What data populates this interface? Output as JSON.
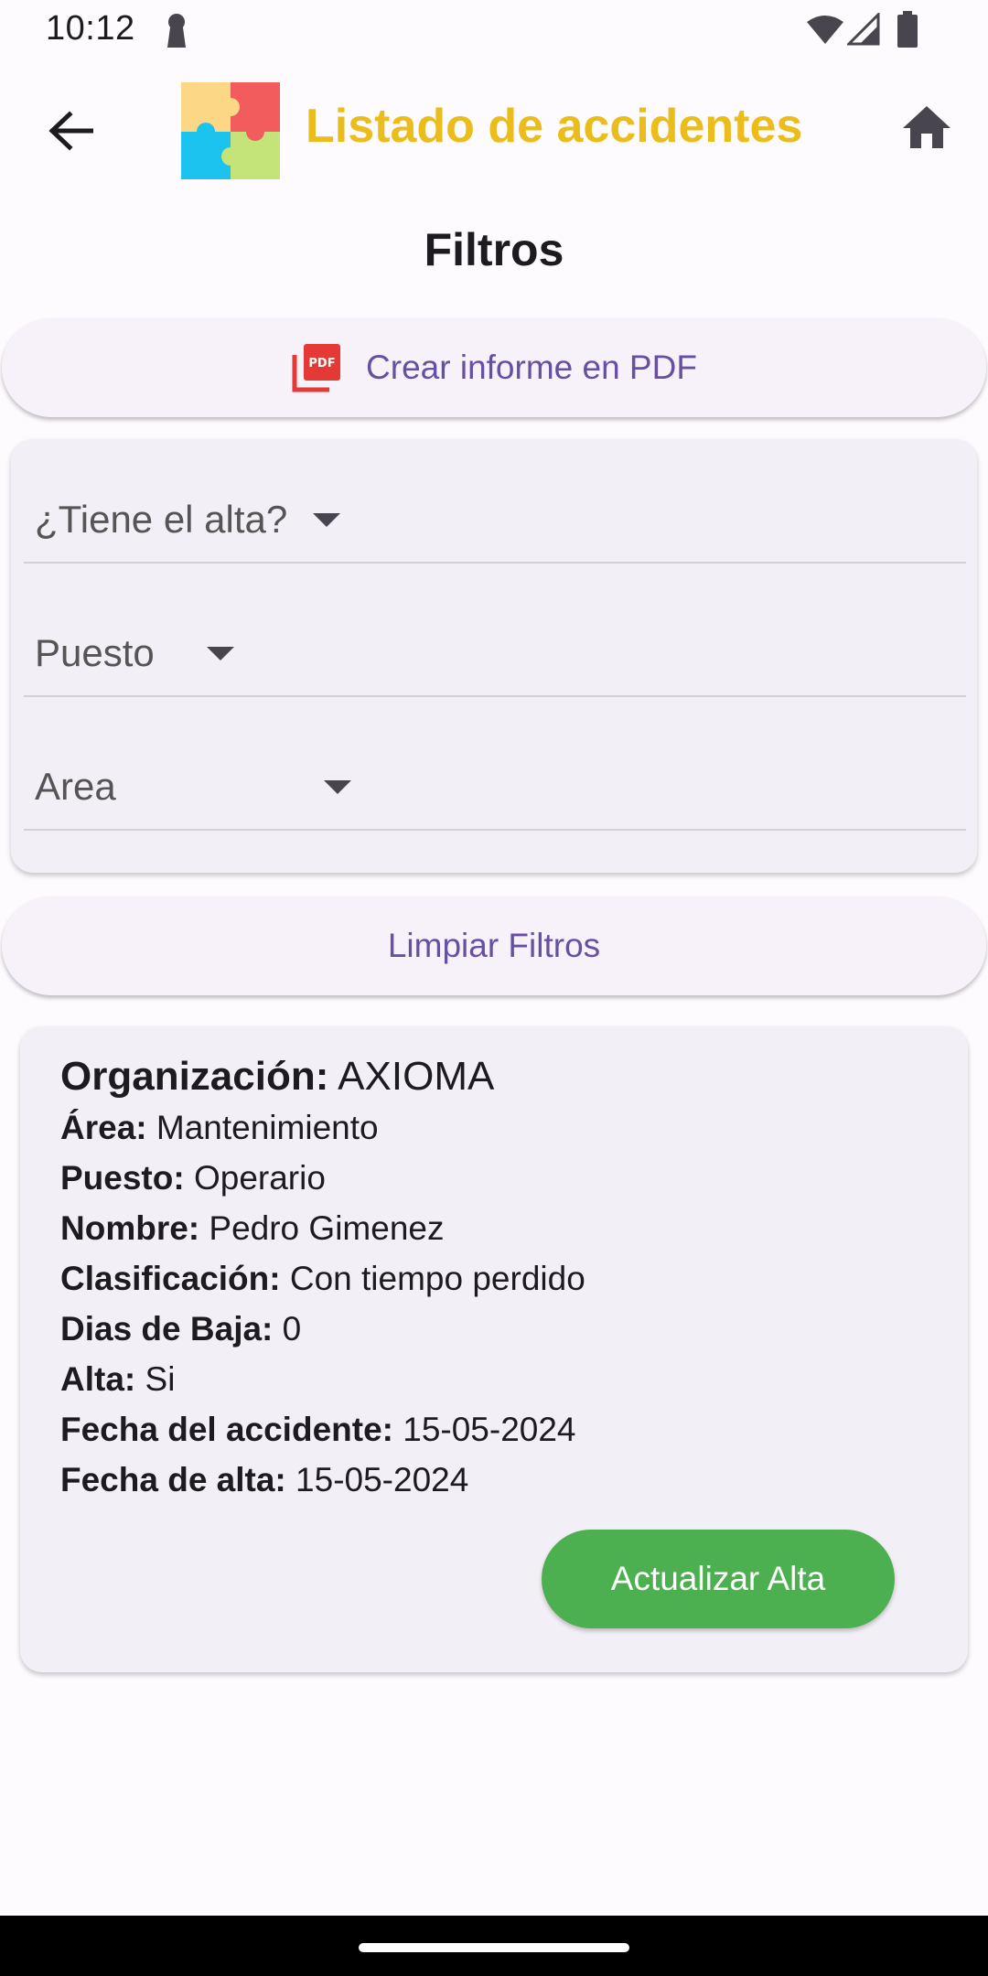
{
  "status_bar": {
    "time": "10:12",
    "icons": [
      "lock-icon",
      "wifi-icon",
      "signal-icon",
      "battery-icon"
    ]
  },
  "app_bar": {
    "title": "Listado de accidentes",
    "title_color": "#ebbd1c",
    "icons": [
      "back-arrow-icon",
      "puzzle-logo-icon",
      "home-icon"
    ]
  },
  "filters": {
    "heading": "Filtros",
    "pdf_button_label": "Crear informe en PDF",
    "dropdowns": [
      {
        "label": "¿Tiene el alta?"
      },
      {
        "label": "Puesto"
      },
      {
        "label": "Area"
      }
    ],
    "clear_button_label": "Limpiar Filtros",
    "accent_color": "#6750a4"
  },
  "accident": {
    "organization_label": "Organización:",
    "organization_value": "AXIOMA",
    "fields": [
      {
        "label": "Área:",
        "value": "Mantenimiento"
      },
      {
        "label": "Puesto:",
        "value": "Operario"
      },
      {
        "label": "Nombre:",
        "value": "Pedro Gimenez"
      },
      {
        "label": "Clasificación:",
        "value": "Con tiempo perdido"
      },
      {
        "label": "Dias de Baja:",
        "value": "0"
      },
      {
        "label": "Alta:",
        "value": "Si"
      },
      {
        "label": "Fecha del accidente:",
        "value": "15-05-2024"
      },
      {
        "label": "Fecha de alta:",
        "value": "15-05-2024"
      }
    ],
    "update_button_label": "Actualizar Alta",
    "update_button_color": "#4caf50"
  }
}
